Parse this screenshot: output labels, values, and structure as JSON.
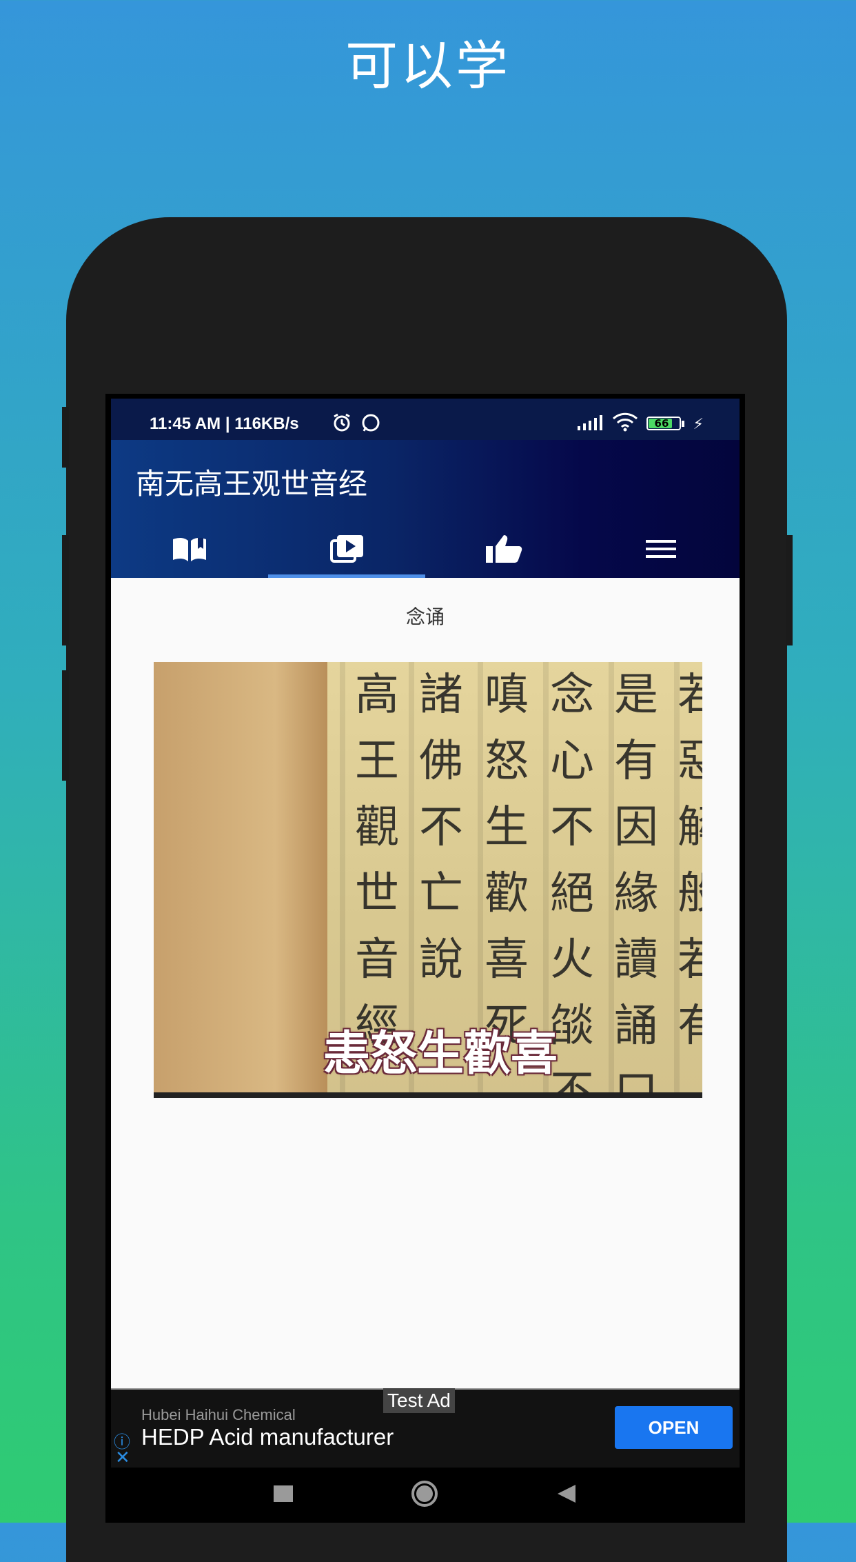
{
  "promo": {
    "title": "可以学"
  },
  "statusbar": {
    "time": "11:45 AM | 116KB/s",
    "battery": "66"
  },
  "app": {
    "title": "南无高王观世音经"
  },
  "tabs": [
    {
      "icon": "book-icon",
      "active": false
    },
    {
      "icon": "video-icon",
      "active": true
    },
    {
      "icon": "thumbs-up-icon",
      "active": false
    },
    {
      "icon": "menu-icon",
      "active": false
    }
  ],
  "content": {
    "label": "念诵",
    "video_subtitle": "恚怒生歡喜"
  },
  "ad": {
    "tag": "Test Ad",
    "advertiser": "Hubei Haihui Chemical",
    "headline": "HEDP Acid manufacturer",
    "cta": "OPEN",
    "info_icon": "ⓘ",
    "close_icon": "✕"
  },
  "navbar": {
    "items": [
      "recents-button",
      "home-button",
      "back-button"
    ]
  }
}
